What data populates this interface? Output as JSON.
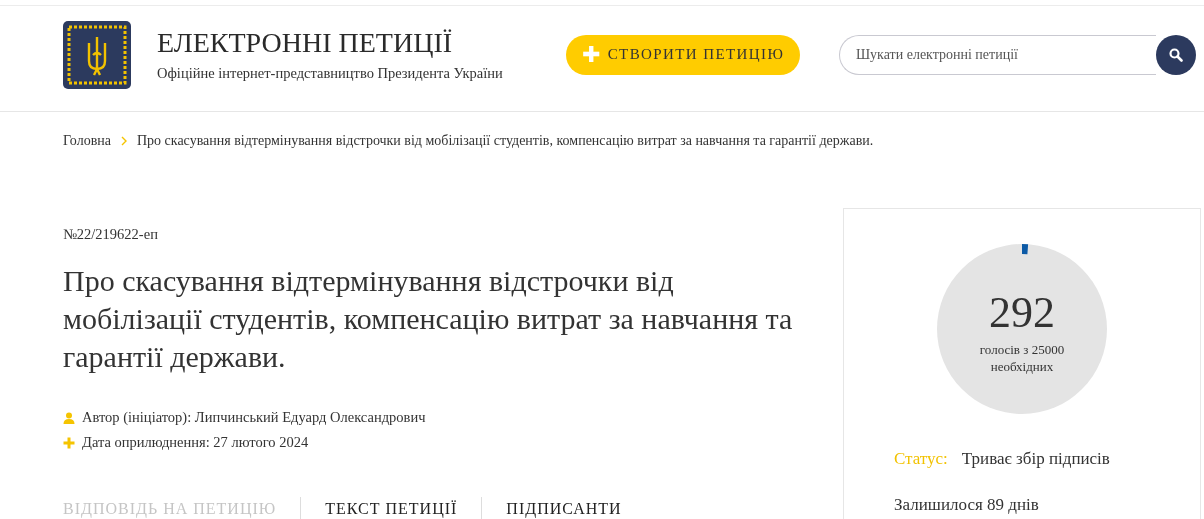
{
  "header": {
    "title": "ЕЛЕКТРОННІ ПЕТИЦІЇ",
    "subtitle": "Офіційне інтернет-представництво Президента України",
    "create_button": {
      "icon": "✚",
      "label": "СТВОРИТИ ПЕТИЦІЮ"
    },
    "search": {
      "placeholder": "Шукати електронні петиції"
    }
  },
  "breadcrumbs": [
    {
      "label": "Головна"
    },
    {
      "label": "Про скасування відтермінування відстрочки від мобілізації студентів, компенсацію витрат за навчання та гарантії держави."
    }
  ],
  "petition": {
    "number": "№22/219622-еп",
    "title": "Про скасування відтермінування відстрочки від мобілізації студентів, компенсацію витрат за навчання та гарантії держави.",
    "meta": [
      {
        "kind": "author",
        "text": "Автор (ініціатор): Липчинський Едуард Олександрович"
      },
      {
        "kind": "date",
        "text": "Дата оприлюднення: 27 лютого 2024"
      }
    ]
  },
  "tabs": [
    {
      "label": "ВІДПОВІДЬ НА ПЕТИЦІЮ",
      "disabled": true
    },
    {
      "label": "ТЕКСТ ПЕТИЦІЇ",
      "disabled": false
    },
    {
      "label": "ПІДПИСАНТИ",
      "disabled": false
    }
  ],
  "votes": {
    "count": "292",
    "caption": "голосів з 25000 необхідних",
    "level": 0.0117,
    "status_label": "Статус:",
    "status": "Триває збір підписів",
    "remaining": "Залишилося 89 днів"
  }
}
